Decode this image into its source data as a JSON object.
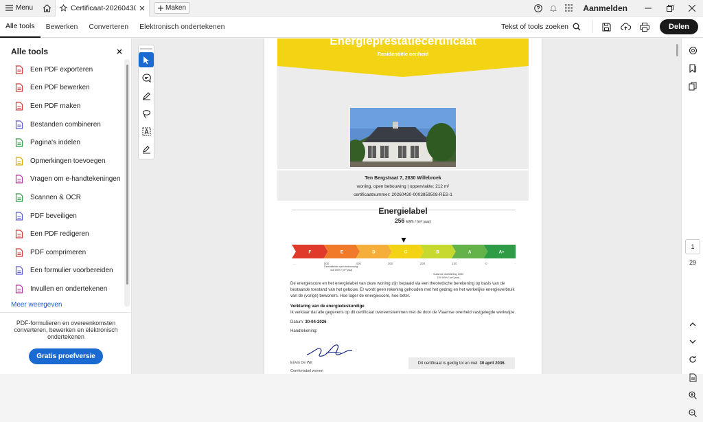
{
  "titlebar": {
    "menu_label": "Menu",
    "tab_title": "Certificaat-20260430-...",
    "new_tab_label": "Maken",
    "signin_label": "Aanmelden"
  },
  "toolbar": {
    "tabs": [
      "Alle tools",
      "Bewerken",
      "Converteren",
      "Elektronisch ondertekenen"
    ],
    "search_label": "Tekst of tools zoeken",
    "share_label": "Delen"
  },
  "sidebar": {
    "title": "Alle tools",
    "items": [
      {
        "label": "Een PDF exporteren",
        "icon": "export-pdf-icon",
        "color": "#d63b3b"
      },
      {
        "label": "Een PDF bewerken",
        "icon": "edit-pdf-icon",
        "color": "#d63b3b"
      },
      {
        "label": "Een PDF maken",
        "icon": "create-pdf-icon",
        "color": "#d63b3b"
      },
      {
        "label": "Bestanden combineren",
        "icon": "combine-files-icon",
        "color": "#5b5bd6"
      },
      {
        "label": "Pagina's indelen",
        "icon": "organize-pages-icon",
        "color": "#2e9d4a"
      },
      {
        "label": "Opmerkingen toevoegen",
        "icon": "comment-icon",
        "color": "#e0a700"
      },
      {
        "label": "Vragen om e-handtekeningen",
        "icon": "request-esign-icon",
        "color": "#b43aa3"
      },
      {
        "label": "Scannen & OCR",
        "icon": "scan-ocr-icon",
        "color": "#2e9d4a"
      },
      {
        "label": "PDF beveiligen",
        "icon": "protect-pdf-icon",
        "color": "#5b5bd6"
      },
      {
        "label": "Een PDF redigeren",
        "icon": "redact-pdf-icon",
        "color": "#d63b3b"
      },
      {
        "label": "PDF comprimeren",
        "icon": "compress-pdf-icon",
        "color": "#d63b3b"
      },
      {
        "label": "Een formulier voorbereiden",
        "icon": "prepare-form-icon",
        "color": "#5b5bd6"
      },
      {
        "label": "Invullen en ondertekenen",
        "icon": "fill-sign-icon",
        "color": "#b43aa3"
      }
    ],
    "more_label": "Meer weergeven",
    "promo_text": "PDF-formulieren en overeenkomsten converteren, bewerken en elektronisch ondertekenen",
    "trial_label": "Gratis proefversie"
  },
  "document": {
    "title": "Energieprestatiecertificaat",
    "subtitle": "Residentiële eenheid",
    "address": "Ten Bergstraat 7, 2830 Willebroek",
    "details": "woning, open bebouwing | oppervlakte: 212 m²",
    "cert_number": "certificaatnummer: 20260430-0003859508-RES-1",
    "energielabel_title": "Energielabel",
    "score_value": "256",
    "score_unit": "kWh / (m² jaar)",
    "labels": [
      "F",
      "E",
      "D",
      "C",
      "B",
      "A",
      "A+"
    ],
    "label_colors": [
      "#e03a2b",
      "#f07a2a",
      "#f5ae3a",
      "#f3d415",
      "#c6d92e",
      "#63b34a",
      "#2e9b45"
    ],
    "ticks": [
      "...",
      "500",
      "400",
      "300",
      "200",
      "100",
      "0",
      "+100"
    ],
    "avg_note_1": "Gemiddelde open bebouwing:",
    "avg_note_2": "418 kWh / (m² jaar)",
    "target_note_1": "Vlaamse doelstelling 2050",
    "target_note_2": "100 kWh / (m² jaar)",
    "paragraph": "De energiescore en het energielabel van deze woning zijn bepaald via een theoretische berekening op basis van de bestaande toestand van het gebouw. Er wordt geen rekening gehouden met het gedrag en het werkelijke energieverbruik van de (vorige) bewoners. Hoe lager de energiescore, hoe beter.",
    "declaration_title": "Verklaring van de energiedeskundige",
    "declaration_text": "Ik verklaar dat alle gegevens op dit certificaat overeenstemmen met de door de Vlaamse overheid vastgelegde werkwijze.",
    "date_label": "Datum:",
    "date_value": "30-04-2026",
    "signature_label": "Handtekening:",
    "signer_name": "Erwin De Wit",
    "signer_line2": "Comfortabel wonen",
    "valid_text": "Dit certificaat is geldig tot en met",
    "valid_date": "30 april 2036."
  },
  "pager": {
    "current_page": "1",
    "total_pages": "29"
  }
}
